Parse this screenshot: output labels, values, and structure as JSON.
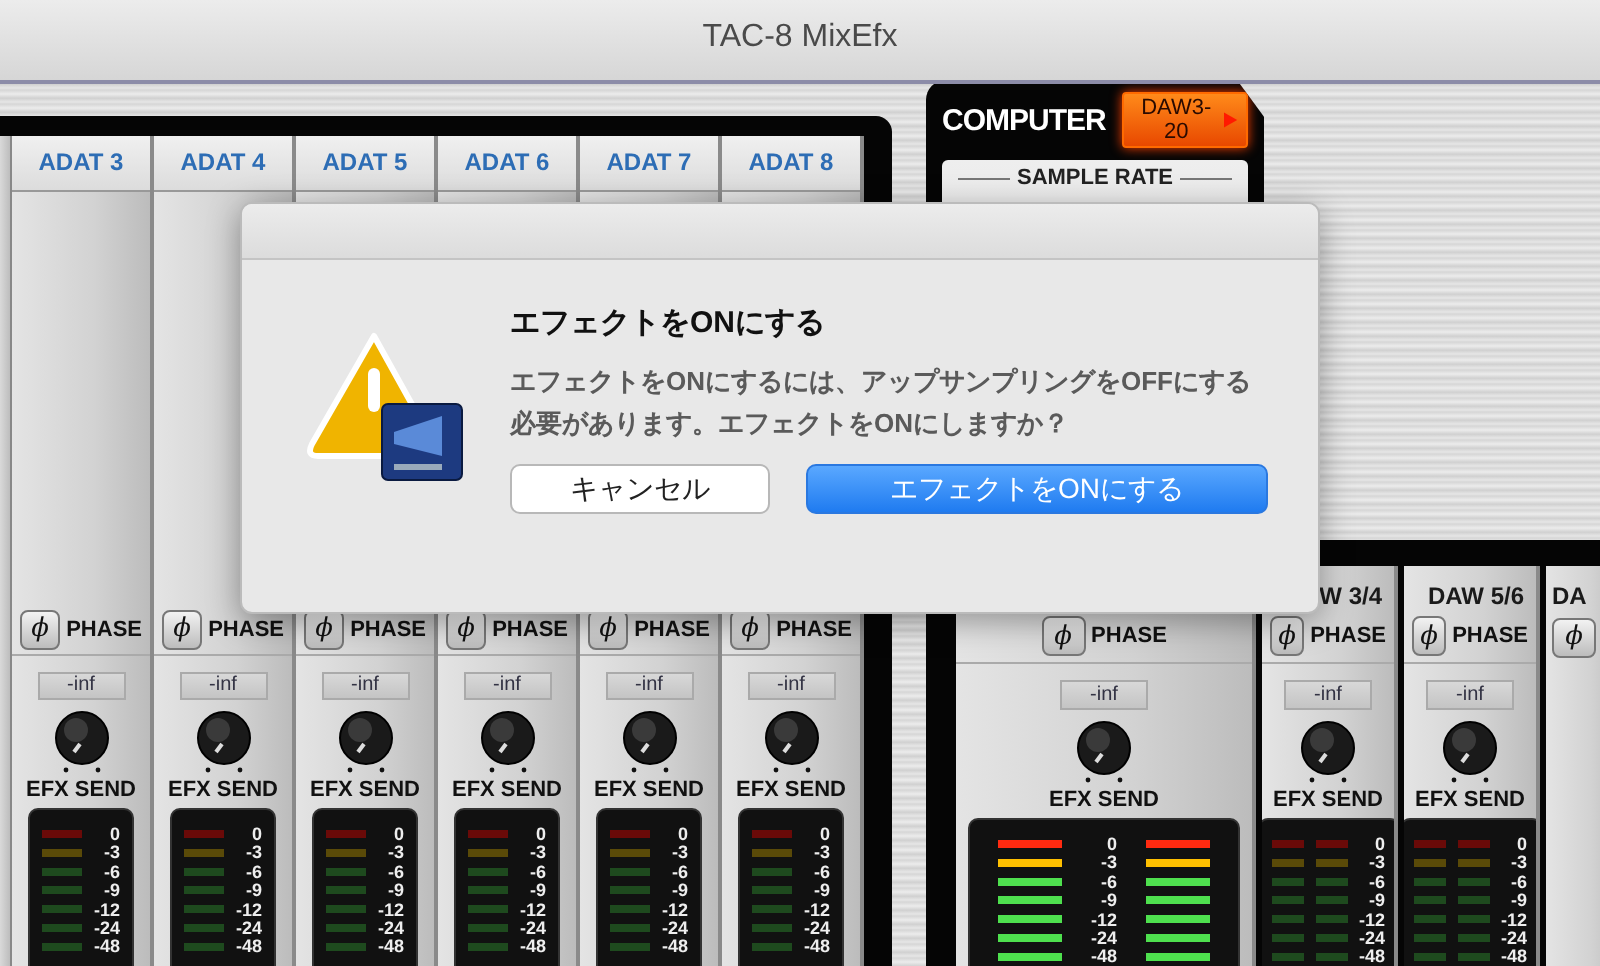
{
  "window": {
    "title": "TAC-8 MixEfx"
  },
  "input_channels": [
    {
      "name": "ADAT 3",
      "phase_symbol": "ϕ",
      "phase_label": "PHASE",
      "readout": "-inf",
      "send_label": "EFX SEND",
      "meter": {
        "lit": false,
        "scale": [
          "0",
          "-3",
          "-6",
          "-9",
          "-12",
          "-24",
          "-48"
        ]
      }
    },
    {
      "name": "ADAT 4",
      "phase_symbol": "ϕ",
      "phase_label": "PHASE",
      "readout": "-inf",
      "send_label": "EFX SEND",
      "meter": {
        "lit": false,
        "scale": [
          "0",
          "-3",
          "-6",
          "-9",
          "-12",
          "-24",
          "-48"
        ]
      }
    },
    {
      "name": "ADAT 5",
      "phase_symbol": "ϕ",
      "phase_label": "PHASE",
      "readout": "-inf",
      "send_label": "EFX SEND",
      "meter": {
        "lit": false,
        "scale": [
          "0",
          "-3",
          "-6",
          "-9",
          "-12",
          "-24",
          "-48"
        ]
      }
    },
    {
      "name": "ADAT 6",
      "phase_symbol": "ϕ",
      "phase_label": "PHASE",
      "readout": "-inf",
      "send_label": "EFX SEND",
      "meter": {
        "lit": false,
        "scale": [
          "0",
          "-3",
          "-6",
          "-9",
          "-12",
          "-24",
          "-48"
        ]
      }
    },
    {
      "name": "ADAT 7",
      "phase_symbol": "ϕ",
      "phase_label": "PHASE",
      "readout": "-inf",
      "send_label": "EFX SEND",
      "meter": {
        "lit": false,
        "scale": [
          "0",
          "-3",
          "-6",
          "-9",
          "-12",
          "-24",
          "-48"
        ]
      }
    },
    {
      "name": "ADAT 8",
      "phase_symbol": "ϕ",
      "phase_label": "PHASE",
      "readout": "-inf",
      "send_label": "EFX SEND",
      "meter": {
        "lit": false,
        "scale": [
          "0",
          "-3",
          "-6",
          "-9",
          "-12",
          "-24",
          "-48"
        ]
      }
    }
  ],
  "computer": {
    "title": "COMPUTER",
    "route": "DAW3-20",
    "sample_rate_label": "SAMPLE RATE"
  },
  "output_channels": [
    {
      "kind": "master",
      "phase_symbol": "ϕ",
      "phase_label": "PHASE",
      "readout": "-inf",
      "send_label": "EFX SEND",
      "meter": {
        "lit": true,
        "scale": [
          "0",
          "-3",
          "-6",
          "-9",
          "-12",
          "-24",
          "-48"
        ]
      }
    },
    {
      "kind": "stereo",
      "name": "W 3/4",
      "phase_symbol": "ϕ",
      "phase_label": "PHASE",
      "readout": "-inf",
      "send_label": "EFX SEND",
      "meter": {
        "lit": false,
        "scale": [
          "0",
          "-3",
          "-6",
          "-9",
          "-12",
          "-24",
          "-48"
        ]
      }
    },
    {
      "kind": "stereo",
      "name": "DAW 5/6",
      "phase_symbol": "ϕ",
      "phase_label": "PHASE",
      "readout": "-inf",
      "send_label": "EFX SEND",
      "meter": {
        "lit": false,
        "scale": [
          "0",
          "-3",
          "-6",
          "-9",
          "-12",
          "-24",
          "-48"
        ]
      }
    },
    {
      "kind": "partial",
      "name": "DA",
      "phase_symbol": "ϕ"
    }
  ],
  "dialog": {
    "title": "エフェクトをONにする",
    "message": "エフェクトをONにするには、アップサンプリングをOFFにする必要があります。エフェクトをONにしますか？",
    "buttons": [
      {
        "label": "キャンセル",
        "kind": "default"
      },
      {
        "label": "エフェクトをONにする",
        "kind": "primary"
      }
    ]
  }
}
